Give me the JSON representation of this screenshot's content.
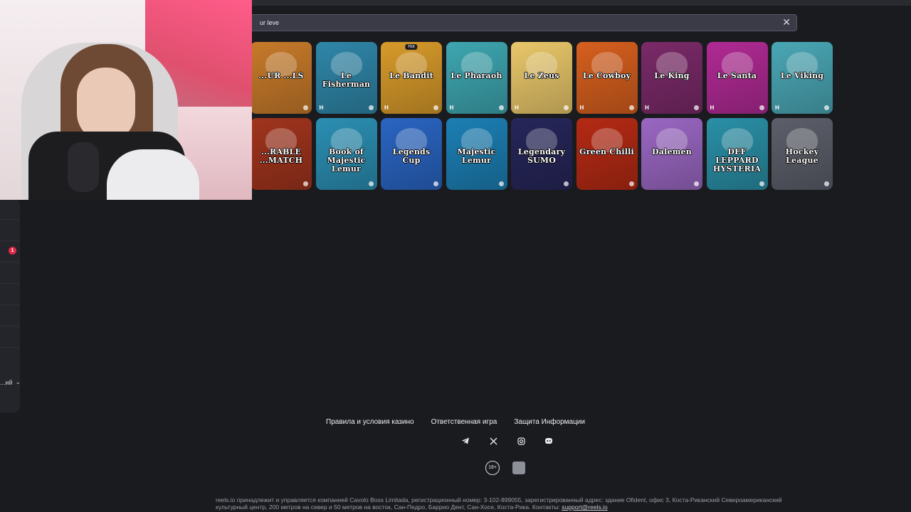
{
  "search": {
    "value": "ur leve"
  },
  "games_row1": [
    {
      "title": "...UR ...LS",
      "provider": "",
      "bg": "#c77a2a"
    },
    {
      "title": "Le Fisherman",
      "provider": "H",
      "bg": "#2f86a8"
    },
    {
      "title": "Le Bandit",
      "provider": "H",
      "bg": "#d79a2a",
      "badge": "Hot"
    },
    {
      "title": "Le Pharaoh",
      "provider": "H",
      "bg": "#3ea6b0"
    },
    {
      "title": "Le Zeus",
      "provider": "H",
      "bg": "#e9c76a"
    },
    {
      "title": "Le Cowboy",
      "provider": "H",
      "bg": "#d65f1e"
    },
    {
      "title": "Le King",
      "provider": "H",
      "bg": "#7a2a68"
    },
    {
      "title": "Le Santa",
      "provider": "H",
      "bg": "#b02a94"
    },
    {
      "title": "Le Viking",
      "provider": "H",
      "bg": "#4aa7b5"
    }
  ],
  "games_row2": [
    {
      "title": "...RABLE ...MATCH",
      "provider": "",
      "bg": "#a0341d"
    },
    {
      "title": "Book of Majestic Lemur",
      "provider": "",
      "bg": "#2b8fb3"
    },
    {
      "title": "Legends Cup",
      "provider": "",
      "bg": "#2a65c2"
    },
    {
      "title": "Majestic Lemur",
      "provider": "",
      "bg": "#1c7fb4"
    },
    {
      "title": "Legendary SUMO",
      "provider": "",
      "bg": "#26265a"
    },
    {
      "title": "Green Chilli",
      "provider": "",
      "bg": "#b42a14"
    },
    {
      "title": "Dalemen",
      "provider": "",
      "bg": "#9a67c2"
    },
    {
      "title": "DEF LEPPARD HYSTERIA",
      "provider": "",
      "bg": "#2a8fa6"
    },
    {
      "title": "Hockey League",
      "provider": "",
      "bg": "#5c5f6a"
    }
  ],
  "footer": {
    "links": [
      "Правила и условия казино",
      "Ответственная игра",
      "Защита Информации"
    ],
    "age_badge": "18+",
    "legal_text": "reels.io принадлежит и управляется компанией Cavolo Boss Limitada, регистрационный номер: 3-102-899055, зарегистрированный адрес: здание Ofident, офис 3, Коста-Риканский Североамериканский культурный центр, 200 метров на север и 50 метров на восток, Сан-Педро, Баррио Дент, Сан-Хосе, Коста-Рика. Контакты:",
    "contact_email": "support@reels.io"
  },
  "sidebar": {
    "badge_count": "1",
    "language_label": "...ий"
  },
  "icons": {
    "close": "close-icon",
    "socials": [
      "telegram-icon",
      "x-icon",
      "instagram-icon",
      "discord-icon"
    ]
  }
}
